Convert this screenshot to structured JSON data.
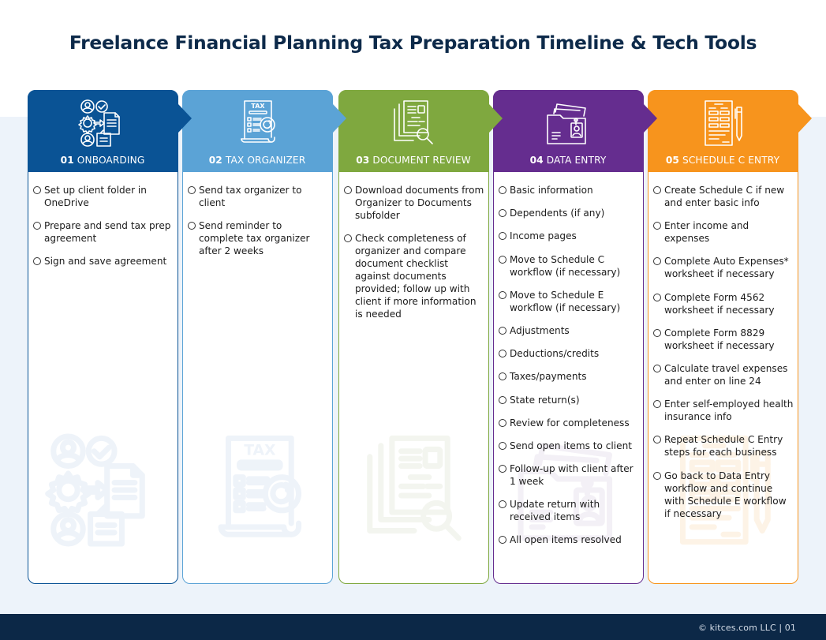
{
  "title": "Freelance Financial Planning Tax Preparation Timeline & Tech Tools",
  "footer": "© kitces.com LLC  |  01",
  "colors": {
    "title": "#0d2a4a",
    "band": "#edf3fa",
    "footer": "#0c2847"
  },
  "steps": [
    {
      "number": "01",
      "label": "ONBOARDING",
      "color": "#0a5395",
      "icon": "onboarding-people-gear-icon",
      "items": [
        "Set up client folder in OneDrive",
        "Prepare and send tax prep agreement",
        "Sign and save agreement"
      ]
    },
    {
      "number": "02",
      "label": "TAX ORGANIZER",
      "color": "#5ba3d6",
      "icon": "tax-document-icon",
      "items": [
        "Send tax organizer to client",
        "Send reminder to complete tax organizer after 2 weeks"
      ]
    },
    {
      "number": "03",
      "label": "DOCUMENT REVIEW",
      "color": "#7fa83f",
      "icon": "document-search-icon",
      "items": [
        "Download documents from Organizer to Documents subfolder",
        "Check completeness of organizer and compare document checklist against documents provided; follow up with client if more information is needed"
      ]
    },
    {
      "number": "04",
      "label": "DATA ENTRY",
      "color": "#652d8f",
      "icon": "folder-id-badge-icon",
      "items": [
        "Basic information",
        "Dependents (if any)",
        "Income pages",
        "Move to Schedule C workflow (if necessary)",
        "Move to Schedule E workflow (if necessary)",
        "Adjustments",
        "Deductions/credits",
        "Taxes/payments",
        "State return(s)",
        "Review for completeness",
        "Send open items to client",
        "Follow-up with client after 1 week",
        "Update return with received items",
        "All open items resolved"
      ]
    },
    {
      "number": "05",
      "label": "SCHEDULE C ENTRY",
      "color": "#f7941d",
      "icon": "form-pen-icon",
      "items": [
        "Create Schedule C if new and enter basic info",
        "Enter income and expenses",
        "Complete Auto Expenses* worksheet if necessary",
        "Complete Form 4562 worksheet if necessary",
        "Complete Form 8829 worksheet if necessary",
        "Calculate travel expenses and enter on line 24",
        "Enter self-employed health insurance info",
        "Repeat Schedule C Entry steps for each business",
        "Go back to Data Entry workflow and continue with Schedule E workflow if necessary"
      ]
    }
  ]
}
